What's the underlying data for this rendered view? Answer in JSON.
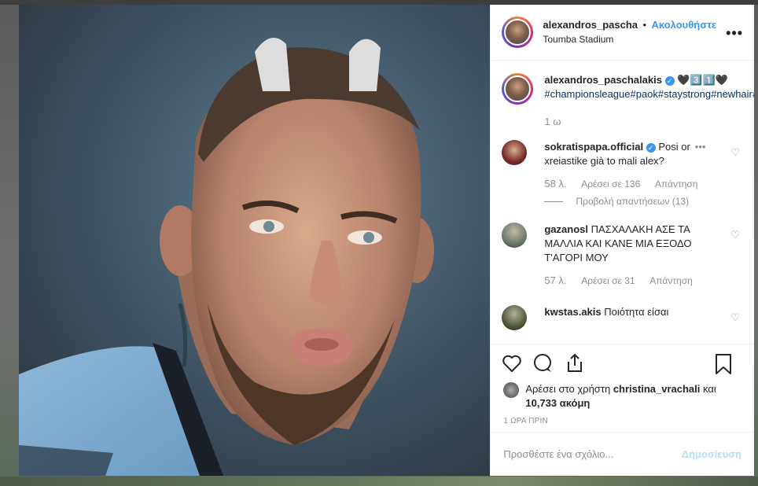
{
  "header": {
    "username": "alexandros_pascha",
    "separator": "•",
    "follow_label": "Ακολουθήστε",
    "location": "Toumba Stadium",
    "more": "•••"
  },
  "caption": {
    "username": "alexandros_paschalakis",
    "verified_mark": "✓",
    "emoji": "🖤3️⃣1️⃣🖤",
    "hashtags": "#championsleague#paok#staystrong#newhair#newseasons#",
    "time_ago": "1 ω"
  },
  "comments": [
    {
      "username": "sokratispapa.official",
      "verified": true,
      "text": "Posi or",
      "text2": "xreiastike già to mali alex?",
      "ellipsis": "•••",
      "time": "58 λ.",
      "likes": "Αρέσει σε 136",
      "reply": "Απάντηση",
      "view_replies": "Προβολή απαντήσεων (13)"
    },
    {
      "username": "gazanosl",
      "text": "ΠΑΣΧΑΛΑΚΗ ΑΣΕ ΤΑ ΜΑΛΛΙΑ ΚΑΙ ΚΑΝΕ ΜΙΑ ΕΞΟΔΟ Τ'ΑΓΟΡΙ ΜΟΥ",
      "time": "57 λ.",
      "likes": "Αρέσει σε 31",
      "reply": "Απάντηση"
    },
    {
      "username": "kwstas.akis",
      "text": "Ποιότητα είσαι"
    }
  ],
  "actions": {
    "like_icon": "heart-icon",
    "comment_icon": "comment-icon",
    "share_icon": "share-icon",
    "save_icon": "bookmark-icon"
  },
  "likes": {
    "prefix": "Αρέσει στο χρήστη",
    "user": "christina_vrachali",
    "middle": "και",
    "count": "10,733 ακόμη"
  },
  "post_time": "1 ΩΡΑ ΠΡΙΝ",
  "add_comment": {
    "placeholder": "Προσθέστε ένα σχόλιο...",
    "post_label": "Δημοσίευση"
  },
  "colors": {
    "link": "#3897f0",
    "hashtag": "#003569",
    "muted": "#8e8e8e",
    "post_disabled": "#b2dffc"
  }
}
